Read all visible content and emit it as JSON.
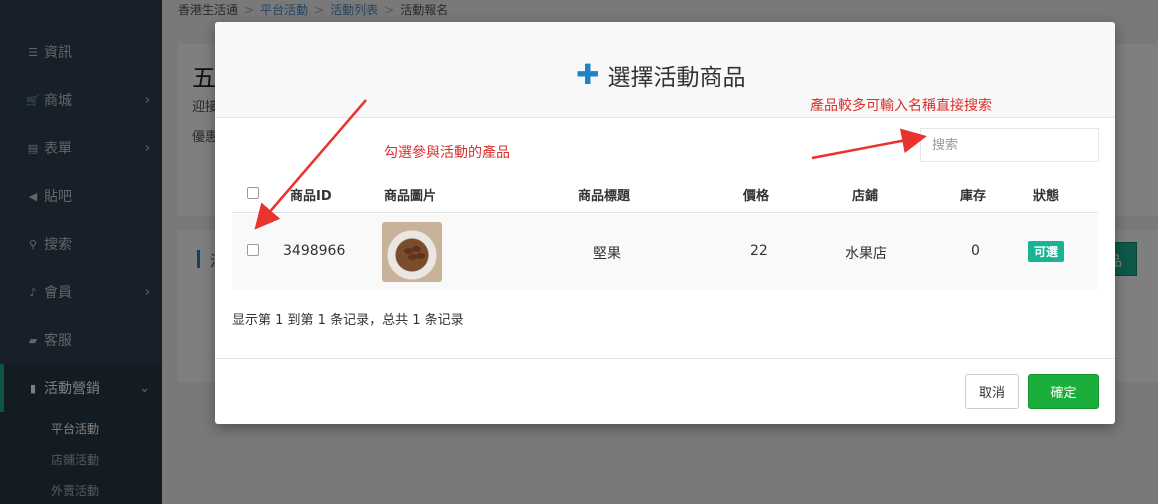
{
  "breadcrumb": [
    "香港生活通",
    "平台活動",
    "活動列表",
    "活動報名"
  ],
  "sidebar": {
    "items": [
      {
        "label": "資訊",
        "icon": "list-icon",
        "chevron": false
      },
      {
        "label": "商城",
        "icon": "cart-icon",
        "chevron": true
      },
      {
        "label": "表單",
        "icon": "form-icon",
        "chevron": true
      },
      {
        "label": "貼吧",
        "icon": "megaphone-icon",
        "chevron": false
      },
      {
        "label": "搜索",
        "icon": "search-icon",
        "chevron": false
      },
      {
        "label": "會員",
        "icon": "bell-icon",
        "chevron": true
      },
      {
        "label": "客服",
        "icon": "chat-icon",
        "chevron": false
      },
      {
        "label": "活動營銷",
        "icon": "bookmark-icon",
        "chevron": true,
        "active": true
      }
    ],
    "submenu": [
      "平台活動",
      "店鋪活動",
      "外賣活動"
    ]
  },
  "background": {
    "title": "五",
    "line1": "迎接",
    "line2": "優惠",
    "section": "活",
    "button": "品"
  },
  "modal": {
    "title": "選擇活動商品",
    "search_placeholder": "搜索",
    "columns": [
      "商品ID",
      "商品圖片",
      "商品標題",
      "價格",
      "店鋪",
      "庫存",
      "狀態"
    ],
    "rows": [
      {
        "id": "3498966",
        "title": "堅果",
        "price": "22",
        "store": "水果店",
        "stock": "0",
        "status": "可選"
      }
    ],
    "footer_text": "显示第 1 到第 1 条记录，总共 1 条记录",
    "cancel_label": "取消",
    "confirm_label": "確定"
  },
  "annotations": {
    "check_hint": "勾選參與活動的產品",
    "search_hint": "產品較多可輸入名稱直接搜索"
  },
  "colors": {
    "sidebar_bg": "#2f4050",
    "accent_green": "#1ab394",
    "confirm_green": "#1aae3a",
    "annotation_red": "#d9302c",
    "plus_blue": "#1c84c6"
  }
}
